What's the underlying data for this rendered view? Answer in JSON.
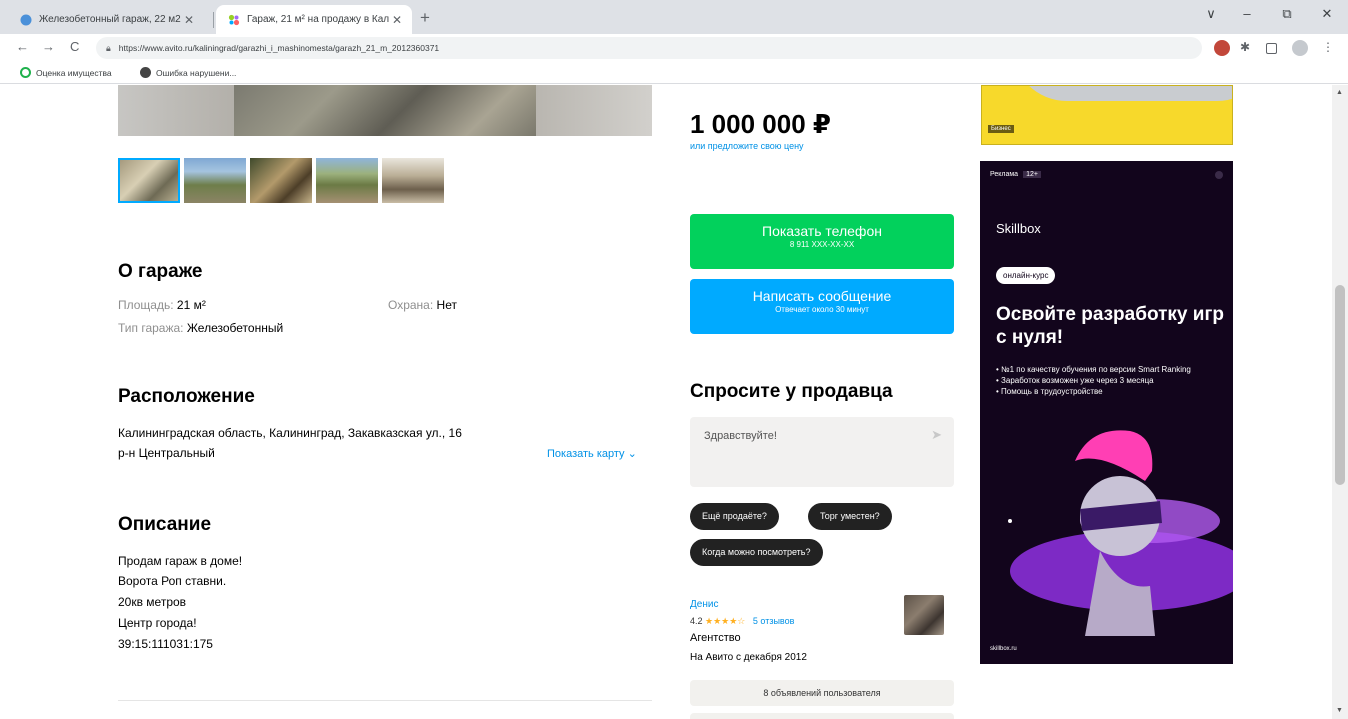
{
  "browser": {
    "tabs": [
      {
        "title": "Железобетонный гараж, 22 м2",
        "active": false
      },
      {
        "title": "Гараж, 21 м² на продажу в Кал",
        "active": true
      }
    ],
    "new_tab": "+",
    "window_controls": {
      "chevron": "∨",
      "minimize": "–",
      "restore": "⧉",
      "close": "✕"
    },
    "nav": {
      "back": "←",
      "forward": "→",
      "reload": "C"
    },
    "url": "https://www.avito.ru/kaliningrad/garazhi_i_mashinomesta/garazh_21_m_2012360371",
    "bookmarks": [
      "Оценка имущества",
      "Ошибка нарушени..."
    ]
  },
  "gallery": {
    "thumb_count": 5,
    "active_index": 0
  },
  "about": {
    "title": "О гараже",
    "area_label": "Площадь:",
    "area_value": "21 м²",
    "guard_label": "Охрана:",
    "guard_value": "Нет",
    "type_label": "Тип гаража:",
    "type_value": "Железобетонный"
  },
  "location": {
    "title": "Расположение",
    "address": "Калининградская область, Калининград, Закавказская ул., 16",
    "district": "р-н Центральный",
    "show_map": "Показать карту"
  },
  "description": {
    "title": "Описание",
    "lines": [
      "Продам гараж в доме!",
      "Ворота Роп ставни.",
      "20кв метров",
      "Центр города!",
      "39:15:111031:175"
    ]
  },
  "offer": {
    "price": "1 000 000 ₽",
    "price_sub": "или предложите свою цену",
    "phone_button": "Показать телефон",
    "phone_sub": "8 911 XXX-XX-XX",
    "message_button": "Написать сообщение",
    "message_sub": "Отвечает около 30 минут"
  },
  "ask": {
    "title": "Спросите у продавца",
    "message_value": "Здравствуйте!",
    "chips": [
      "Ещё продаёте?",
      "Торг уместен?",
      "Когда можно посмотреть?"
    ]
  },
  "seller": {
    "name": "Денис",
    "rating": "4.2",
    "stars": "★★★★☆",
    "reviews": "5 отзывов",
    "type": "Агентство",
    "since": "На Авито с декабря 2012",
    "ads_button": "8 объявлений пользователя"
  },
  "ads": {
    "yellow_tag": "Бизнес",
    "sb_top": "Реклама",
    "sb_age": "12+",
    "sb_brand": "Skillbox",
    "sb_pill": "онлайн-курс",
    "sb_head": "Освойте разработку игр с нуля!",
    "sb_points": [
      "№1 по качеству обучения по версии Smart Ranking",
      "Заработок возможен уже через 3 месяца",
      "Помощь в трудоустройстве"
    ],
    "sb_foot": "skillbox.ru"
  }
}
